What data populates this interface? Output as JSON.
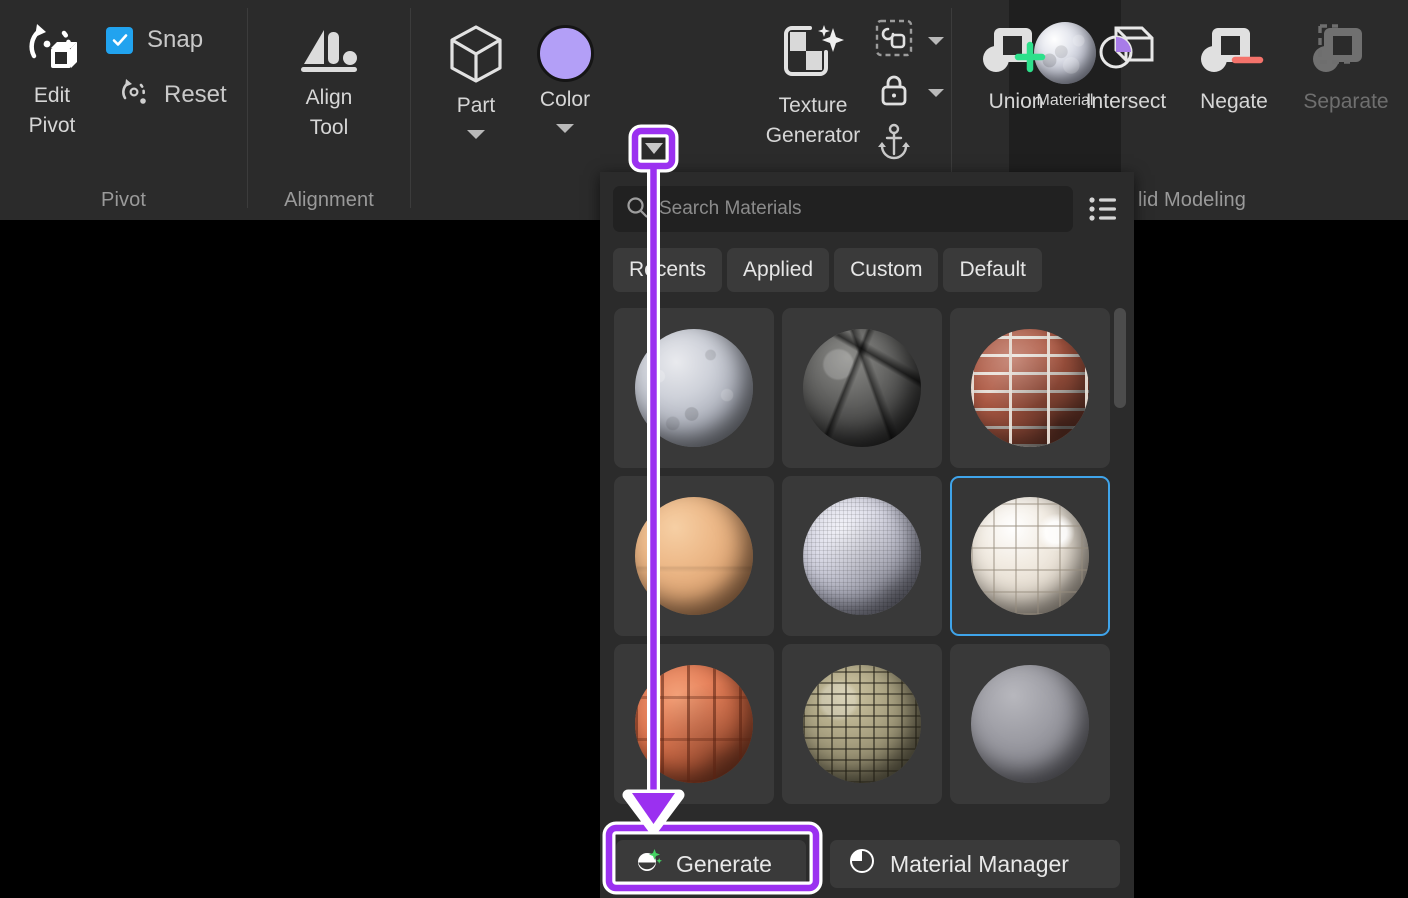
{
  "ribbon": {
    "groups": [
      {
        "name": "pivot",
        "label": "Pivot"
      },
      {
        "name": "alignment",
        "label": "Alignment"
      },
      {
        "name": "solid_modeling",
        "label": "lid Modeling"
      }
    ],
    "pivot": {
      "edit_pivot": {
        "label_line1": "Edit",
        "label_line2": "Pivot",
        "icon": "edit-pivot-icon"
      },
      "snap": {
        "label": "Snap",
        "checked": true,
        "icon": "checkbox-checked-icon"
      },
      "reset": {
        "label": "Reset",
        "icon": "reset-pivot-icon"
      }
    },
    "alignment": {
      "align_tool": {
        "label_line1": "Align",
        "label_line2": "Tool",
        "icon": "align-tool-icon"
      }
    },
    "appearance": {
      "part": {
        "label": "Part",
        "icon": "cube-icon",
        "has_dropdown": true
      },
      "color": {
        "label": "Color",
        "icon": "color-swatch-icon",
        "swatch_hex": "#b39ff7",
        "has_dropdown": true
      },
      "material": {
        "label": "Material",
        "icon": "material-sphere-icon",
        "has_dropdown": true,
        "active": true
      },
      "texture_generator": {
        "label_line1": "Texture",
        "label_line2": "Generator",
        "icon": "texture-generator-icon"
      }
    },
    "tools_column": [
      {
        "name": "group-icon",
        "has_dropdown": true
      },
      {
        "name": "lock-icon",
        "has_dropdown": true
      },
      {
        "name": "anchor-icon",
        "has_dropdown": false
      }
    ],
    "solid_modeling": {
      "union": {
        "label": "Union",
        "icon": "union-icon",
        "accent_hex": "#2de08b",
        "enabled": true
      },
      "intersect": {
        "label": "Intersect",
        "icon": "intersect-icon",
        "accent_hex": "#a87ce8",
        "enabled": true
      },
      "negate": {
        "label": "Negate",
        "icon": "negate-icon",
        "accent_hex": "#f4736b",
        "enabled": true
      },
      "separate": {
        "label": "Separate",
        "icon": "separate-icon",
        "enabled": false
      }
    }
  },
  "material_panel": {
    "search": {
      "placeholder": "Search Materials",
      "value": "",
      "icon": "search-icon"
    },
    "view_toggle": {
      "icon": "list-view-icon"
    },
    "filters": [
      {
        "label": "Recents",
        "active": false
      },
      {
        "label": "Applied",
        "active": false
      },
      {
        "label": "Custom",
        "active": false
      },
      {
        "label": "Default",
        "active": false
      }
    ],
    "materials": [
      {
        "name": "concrete",
        "swatch": "m-concrete",
        "selected": false
      },
      {
        "name": "rock",
        "swatch": "m-rock",
        "selected": false
      },
      {
        "name": "brick",
        "swatch": "m-brick",
        "selected": false
      },
      {
        "name": "skin",
        "swatch": "m-skin",
        "selected": false
      },
      {
        "name": "fabric",
        "swatch": "m-fabric",
        "selected": false
      },
      {
        "name": "ceramic-tile",
        "swatch": "m-tile",
        "selected": true
      },
      {
        "name": "roof-tile",
        "swatch": "m-rooftile",
        "selected": false
      },
      {
        "name": "cobblestone",
        "swatch": "m-cobble",
        "selected": false
      },
      {
        "name": "plastic",
        "swatch": "m-plastic",
        "selected": false
      }
    ],
    "footer": {
      "generate": {
        "label": "Generate",
        "icon": "generate-sparkle-icon",
        "highlighted": true
      },
      "material_manager": {
        "label": "Material Manager",
        "icon": "material-manager-icon"
      }
    },
    "scrollbar": {
      "thumb_top_pct": 0,
      "thumb_height_pct": 18
    }
  },
  "annotation": {
    "accent_hex": "#9b30f0",
    "outline_hex": "#ffffff",
    "from": "material-dropdown-caret",
    "to": "generate-button"
  }
}
